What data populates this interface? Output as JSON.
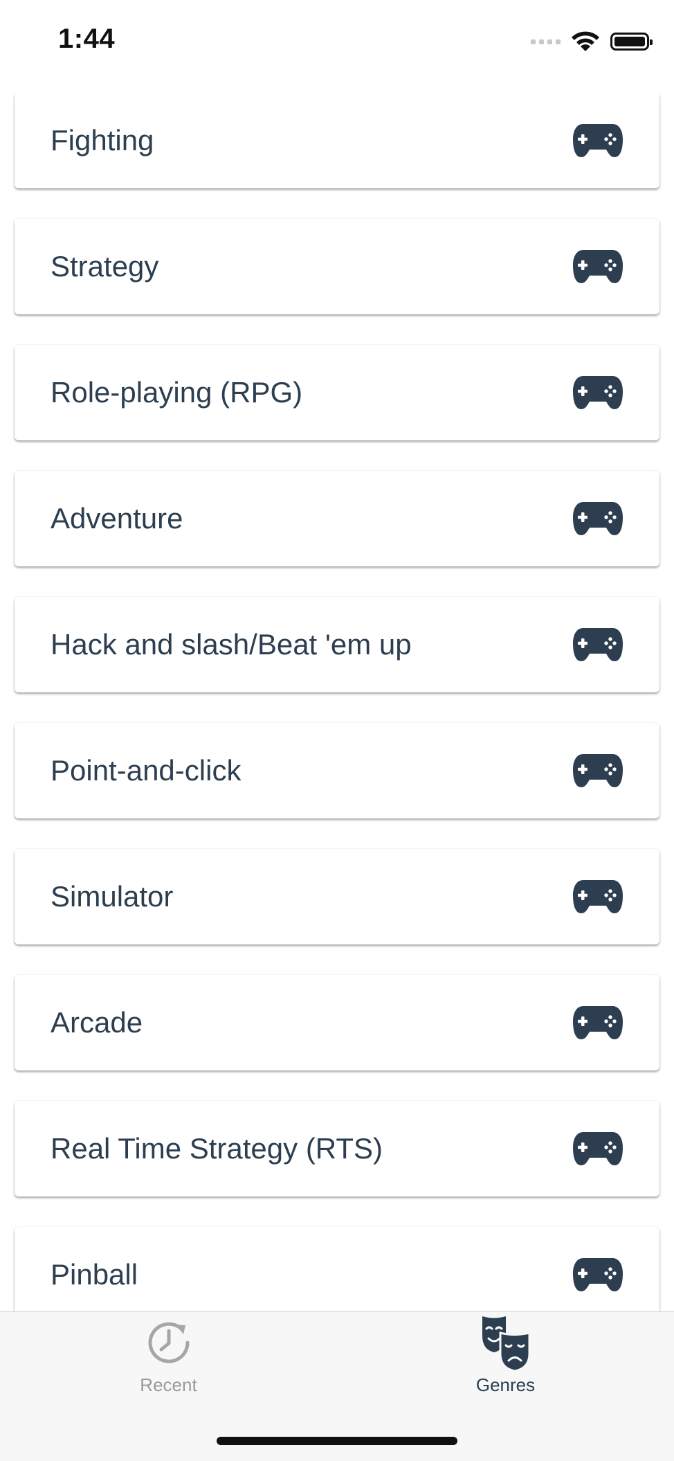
{
  "status_bar": {
    "time": "1:44"
  },
  "genres": [
    {
      "label": "Fighting",
      "icon": "gamepad-icon"
    },
    {
      "label": "Strategy",
      "icon": "gamepad-icon"
    },
    {
      "label": "Role-playing (RPG)",
      "icon": "gamepad-icon"
    },
    {
      "label": "Adventure",
      "icon": "gamepad-icon"
    },
    {
      "label": "Hack and slash/Beat 'em up",
      "icon": "gamepad-icon"
    },
    {
      "label": "Point-and-click",
      "icon": "gamepad-icon"
    },
    {
      "label": "Simulator",
      "icon": "gamepad-icon"
    },
    {
      "label": "Arcade",
      "icon": "gamepad-icon"
    },
    {
      "label": "Real Time Strategy (RTS)",
      "icon": "gamepad-icon"
    },
    {
      "label": "Pinball",
      "icon": "gamepad-icon"
    }
  ],
  "tab_bar": {
    "tabs": [
      {
        "label": "Recent",
        "icon": "history-icon",
        "active": false
      },
      {
        "label": "Genres",
        "icon": "theater-masks-icon",
        "active": true
      }
    ]
  },
  "colors": {
    "primary_text": "#2c3e50",
    "icon_dark": "#2c3e50",
    "tab_inactive": "#9a9a9a",
    "tab_bar_bg": "#f7f7f7"
  }
}
